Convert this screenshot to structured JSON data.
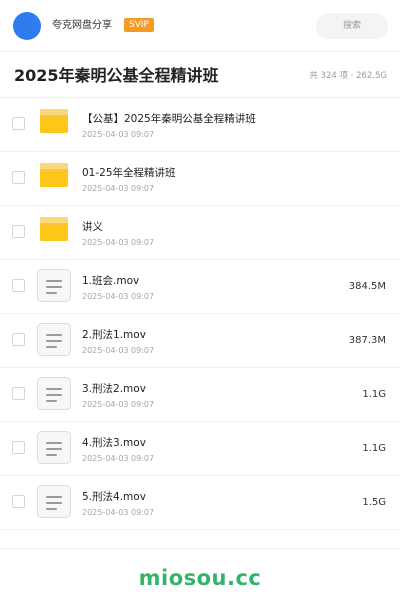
{
  "topbar": {
    "user_name": "夸克网盘分享",
    "badge": "SVIP",
    "search_placeholder": "搜索"
  },
  "header": {
    "title": "2025年秦明公基全程精讲班",
    "summary": "共 324 项 · 262.5G"
  },
  "files": [
    {
      "type": "folder",
      "name": "【公基】2025年秦明公基全程精讲班",
      "date": "2025-04-03 09:07",
      "size": ""
    },
    {
      "type": "folder",
      "name": "01-25年全程精讲班",
      "date": "2025-04-03 09:07",
      "size": ""
    },
    {
      "type": "folder",
      "name": "讲义",
      "date": "2025-04-03 09:07",
      "size": ""
    },
    {
      "type": "file",
      "name": "1.班会.mov",
      "date": "2025-04-03 09:07",
      "size": "384.5M"
    },
    {
      "type": "file",
      "name": "2.刑法1.mov",
      "date": "2025-04-03 09:07",
      "size": "387.3M"
    },
    {
      "type": "file",
      "name": "3.刑法2.mov",
      "date": "2025-04-03 09:07",
      "size": "1.1G"
    },
    {
      "type": "file",
      "name": "4.刑法3.mov",
      "date": "2025-04-03 09:07",
      "size": "1.1G"
    },
    {
      "type": "file",
      "name": "5.刑法4.mov",
      "date": "2025-04-03 09:07",
      "size": "1.5G"
    }
  ],
  "watermark": "miosou.cc",
  "colors": {
    "avatar": "#2f7bf0",
    "badge": "#f59a23",
    "folder": "#ffc61a",
    "watermark": "#36b36a"
  },
  "icons": {
    "folder": "folder-icon",
    "file": "video-file-icon"
  }
}
